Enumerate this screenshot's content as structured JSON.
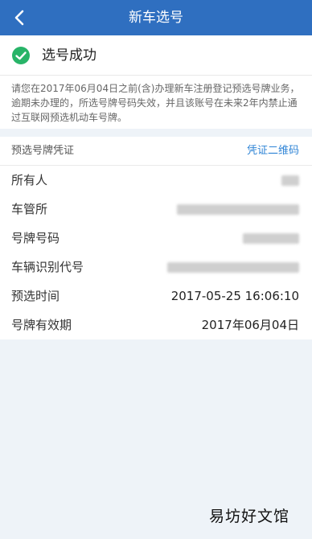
{
  "header": {
    "title": "新车选号",
    "back_icon": "chevron-left-icon"
  },
  "status": {
    "icon": "check-circle-icon",
    "text": "选号成功",
    "color": "#28b468"
  },
  "notice": "请您在2017年06月04日之前(含)办理新车注册登记预选号牌业务，逾期未办理的，所选号牌号码失效，并且该账号在未来2年内禁止通过互联网预选机动车号牌。",
  "voucher": {
    "title": "预选号牌凭证",
    "qr_link": "凭证二维码"
  },
  "fields": [
    {
      "label": "所有人",
      "value": ""
    },
    {
      "label": "车管所",
      "value": ""
    },
    {
      "label": "号牌号码",
      "value": ""
    },
    {
      "label": "车辆识别代号",
      "value": ""
    },
    {
      "label": "预选时间",
      "value": "2017-05-25 16:06:10"
    },
    {
      "label": "号牌有效期",
      "value": "2017年06月04日"
    }
  ],
  "watermark": "易坊好文馆",
  "colors": {
    "header_bg": "#2f6fc0",
    "link": "#2f84d6",
    "page_bg": "#eef3f8"
  }
}
